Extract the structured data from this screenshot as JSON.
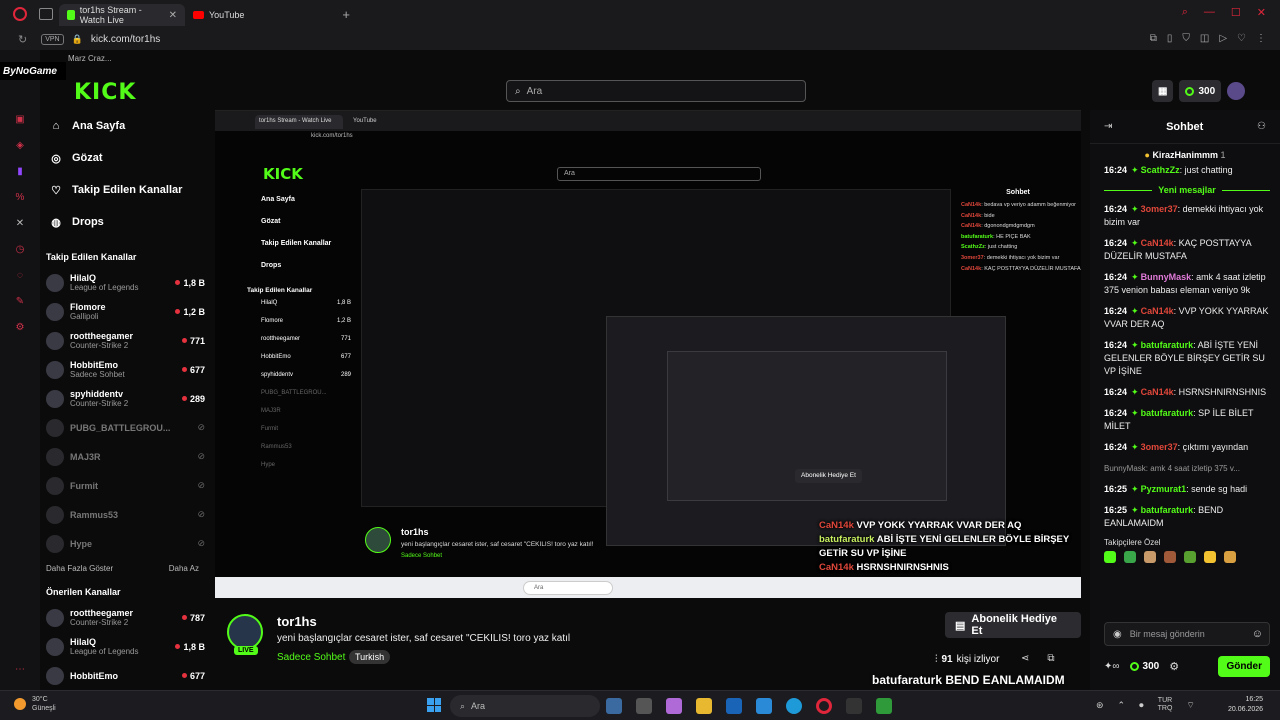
{
  "browser": {
    "tabs": [
      {
        "label": "tor1hs Stream - Watch Live"
      },
      {
        "label": "YouTube"
      }
    ],
    "url": "kick.com/tor1hs",
    "vpn_label": "VPN",
    "bookmark_text": "Marz  Craz..."
  },
  "overlay_brand": "ByNoGame",
  "header": {
    "logo": "KICK",
    "search_placeholder": "Ara",
    "points": "300"
  },
  "sidebar": {
    "nav": [
      {
        "label": "Ana Sayfa",
        "icon": "home-icon"
      },
      {
        "label": "Gözat",
        "icon": "compass-icon"
      },
      {
        "label": "Takip Edilen Kanallar",
        "icon": "heart-icon"
      },
      {
        "label": "Drops",
        "icon": "drops-icon"
      }
    ],
    "followed_title": "Takip Edilen Kanallar",
    "followed": [
      {
        "name": "HilalQ",
        "category": "League of Legends",
        "viewers": "1,8 B",
        "live": true
      },
      {
        "name": "Flomore",
        "category": "Gallipoli",
        "viewers": "1,2 B",
        "live": true
      },
      {
        "name": "roottheegamer",
        "category": "Counter-Strike 2",
        "viewers": "771",
        "live": true
      },
      {
        "name": "HobbitEmo",
        "category": "Sadece Sohbet",
        "viewers": "677",
        "live": true
      },
      {
        "name": "spyhiddentv",
        "category": "Counter-Strike 2",
        "viewers": "289",
        "live": true
      },
      {
        "name": "PUBG_BATTLEGROU...",
        "category": "",
        "viewers": "",
        "live": false
      },
      {
        "name": "MAJ3R",
        "category": "",
        "viewers": "",
        "live": false
      },
      {
        "name": "Furmit",
        "category": "",
        "viewers": "",
        "live": false
      },
      {
        "name": "Rammus53",
        "category": "",
        "viewers": "",
        "live": false
      },
      {
        "name": "Hype",
        "category": "",
        "viewers": "",
        "live": false
      }
    ],
    "show_more": "Daha Fazla Göster",
    "show_less": "Daha Az",
    "recommended_title": "Önerilen Kanallar",
    "recommended": [
      {
        "name": "roottheegamer",
        "category": "Counter-Strike 2",
        "viewers": "787"
      },
      {
        "name": "HilalQ",
        "category": "League of Legends",
        "viewers": "1,8 B"
      },
      {
        "name": "HobbitEmo",
        "category": "",
        "viewers": "677"
      }
    ]
  },
  "player": {
    "inner_tab": "tor1hs Stream - Watch Live",
    "inner_tab2": "YouTube",
    "inner_url": "kick.com/tor1hs",
    "inner_logo": "KICK",
    "inner_search": "Ara",
    "inner_chat_title": "Sohbet",
    "inner_streamer": "tor1hs",
    "inner_title": "yeni başlangıçlar cesaret ister, saf cesaret \"CEKILIS! toro yaz katıl!",
    "inner_category": "Sadece Sohbet",
    "inner_sub_btn": "Abonelik Hediye Et",
    "inner_messages": [
      {
        "user": "CaN14k",
        "text": "bedava vp veriyo adamm beğenmiyor"
      },
      {
        "user": "CaN14k",
        "text": "bide"
      },
      {
        "user": "CaN14k",
        "text": "dgonondgmdgmdgm"
      },
      {
        "user": "batufaraturk",
        "text": "HE PIÇE BAK"
      },
      {
        "user": "ScathzZz",
        "text": "just chatting"
      },
      {
        "user": "3omer37",
        "text": "demekki ihtiyacı yok bizim var"
      },
      {
        "user": "CaN14k",
        "text": "KAÇ POSTTAYYA DÜZELİR MUSTAFA"
      }
    ],
    "overlay_lines": [
      {
        "user": "CaN14k",
        "text": "VVP YOKK YYARRAK VVAR DER AQ"
      },
      {
        "user": "batufaraturk",
        "text": "ABİ İŞTE YENİ GELENLER BÖYLE BİRŞEY GETİR SU VP İŞİNE"
      },
      {
        "user": "CaN14k",
        "text": "HSRNSHNIRNSHNIS"
      }
    ]
  },
  "stream": {
    "streamer": "tor1hs",
    "live": "LIVE",
    "title": "yeni başlangıçlar cesaret ister, saf cesaret \"CEKILIS!  toro yaz katıl",
    "category": "Sadece Sohbet",
    "language": "Turkish",
    "gift_button": "Abonelik Hediye Et",
    "viewers": "91",
    "viewers_label": "kişi izliyor",
    "bottom_overlay": "batufaraturk  BEND EANLAMAIDM"
  },
  "chat": {
    "title": "Sohbet",
    "pinned_user": "KirazHanimmm",
    "pinned_count": "1",
    "new_messages_label": "Yeni mesajlar",
    "messages": [
      {
        "time": "16:24",
        "user": "ScathzZz",
        "color": "#53fc18",
        "text": "just chatting"
      },
      {
        "time": "16:24",
        "user": "3omer37",
        "color": "#e0473a",
        "text": "demekki ihtiyacı yok bizim var"
      },
      {
        "time": "16:24",
        "user": "CaN14k",
        "color": "#e0473a",
        "text": "KAÇ POSTTAYYA DÜZELİR MUSTAFA"
      },
      {
        "time": "16:24",
        "user": "BunnyMask",
        "color": "#e07ad8",
        "text": "amk 4 saat izletip 375 venion babası eleman veniyo 9k"
      },
      {
        "time": "16:24",
        "user": "CaN14k",
        "color": "#e0473a",
        "text": "VVP YOKK YYARRAK VVAR DER AQ"
      },
      {
        "time": "16:24",
        "user": "batufaraturk",
        "color": "#53fc18",
        "text": "ABİ İŞTE YENİ GELENLER BÖYLE BİRŞEY GETİR SU VP İŞİNE"
      },
      {
        "time": "16:24",
        "user": "CaN14k",
        "color": "#e0473a",
        "text": "HSRNSHNIRNSHNIS"
      },
      {
        "time": "16:24",
        "user": "batufaraturk",
        "color": "#53fc18",
        "text": "SP İLE BİLET MİLET"
      },
      {
        "time": "16:24",
        "user": "3omer37",
        "color": "#e0473a",
        "text": "çıktımı yayından"
      }
    ],
    "reply_preview": "BunnyMask: amk 4 saat izletip 375 v...",
    "messages2": [
      {
        "time": "16:25",
        "user": "Pyzmurat1",
        "color": "#53fc18",
        "text": "sende sg hadi"
      },
      {
        "time": "16:25",
        "user": "batufaraturk",
        "color": "#53fc18",
        "text": "BEND EANLAMAIDM"
      }
    ],
    "emote_header": "Takipçilere Özel",
    "input_placeholder": "Bir mesaj gönderin",
    "points": "300",
    "send_label": "Gönder"
  },
  "taskbar": {
    "weather_temp": "30°C",
    "weather_desc": "Güneşli",
    "search_placeholder": "Ara",
    "lang_top": "TUR",
    "lang_bottom": "TRQ",
    "time": "16:25",
    "date": "20.06.2026"
  }
}
